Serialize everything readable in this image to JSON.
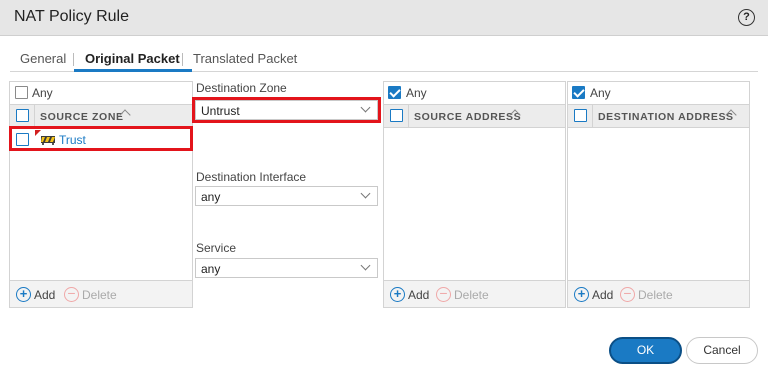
{
  "dialog": {
    "title": "NAT Policy Rule",
    "help_icon": "help-icon"
  },
  "tabs": [
    {
      "label": "General"
    },
    {
      "label": "Original Packet",
      "active": true
    },
    {
      "label": "Translated Packet"
    }
  ],
  "source_zone": {
    "any_label": "Any",
    "any_checked": false,
    "header": "SOURCE ZONE",
    "items": [
      {
        "label": "Trust",
        "icon": "zone-icon"
      }
    ],
    "add_label": "Add",
    "delete_label": "Delete"
  },
  "middle": {
    "destination_zone_label": "Destination Zone",
    "destination_zone_value": "Untrust",
    "destination_interface_label": "Destination Interface",
    "destination_interface_value": "any",
    "service_label": "Service",
    "service_value": "any"
  },
  "source_address": {
    "any_label": "Any",
    "any_checked": true,
    "header": "SOURCE ADDRESS",
    "add_label": "Add",
    "delete_label": "Delete"
  },
  "destination_address": {
    "any_label": "Any",
    "any_checked": true,
    "header": "DESTINATION ADDRESS",
    "add_label": "Add",
    "delete_label": "Delete"
  },
  "buttons": {
    "ok": "OK",
    "cancel": "Cancel"
  },
  "colors": {
    "accent": "#1a7ac4",
    "highlight": "#e3141b",
    "delete_disabled": "#f0a8a8"
  }
}
